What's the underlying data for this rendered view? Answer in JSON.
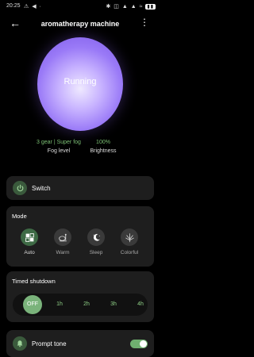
{
  "status_bar": {
    "time": "20:25",
    "left_icons": "⚠ ◀ ·",
    "right_icons": "✱ ◫ ▲ ▲ ≈",
    "battery": "▮▮"
  },
  "header": {
    "back_icon": "arrow-left-icon",
    "title": "aromatherapy machine",
    "more_icon": "more-vertical-icon"
  },
  "device": {
    "state": "Running",
    "fog_value": "3 gear | Super fog",
    "fog_label": "Fog level",
    "brightness_value": "100%",
    "brightness_label": "Brightness"
  },
  "switch_card": {
    "label": "Switch",
    "icon": "power-icon"
  },
  "mode_card": {
    "title": "Mode",
    "items": [
      {
        "label": "Auto",
        "icon": "grid-icon",
        "active": true
      },
      {
        "label": "Warm",
        "icon": "lamp-icon",
        "active": false
      },
      {
        "label": "Sleep",
        "icon": "moon-icon",
        "active": false
      },
      {
        "label": "Colorful",
        "icon": "sparkle-icon",
        "active": false
      }
    ]
  },
  "timer_card": {
    "title": "Timed shutdown",
    "options": [
      "OFF",
      "1h",
      "2h",
      "3h",
      "4h"
    ],
    "selected": "OFF"
  },
  "prompt_card": {
    "label": "Prompt tone",
    "icon": "bell-icon",
    "enabled": true
  },
  "colors": {
    "accent_green": "#7ab37b",
    "orb_purple": "#9a7af7",
    "card_bg": "#1e1e1e"
  }
}
